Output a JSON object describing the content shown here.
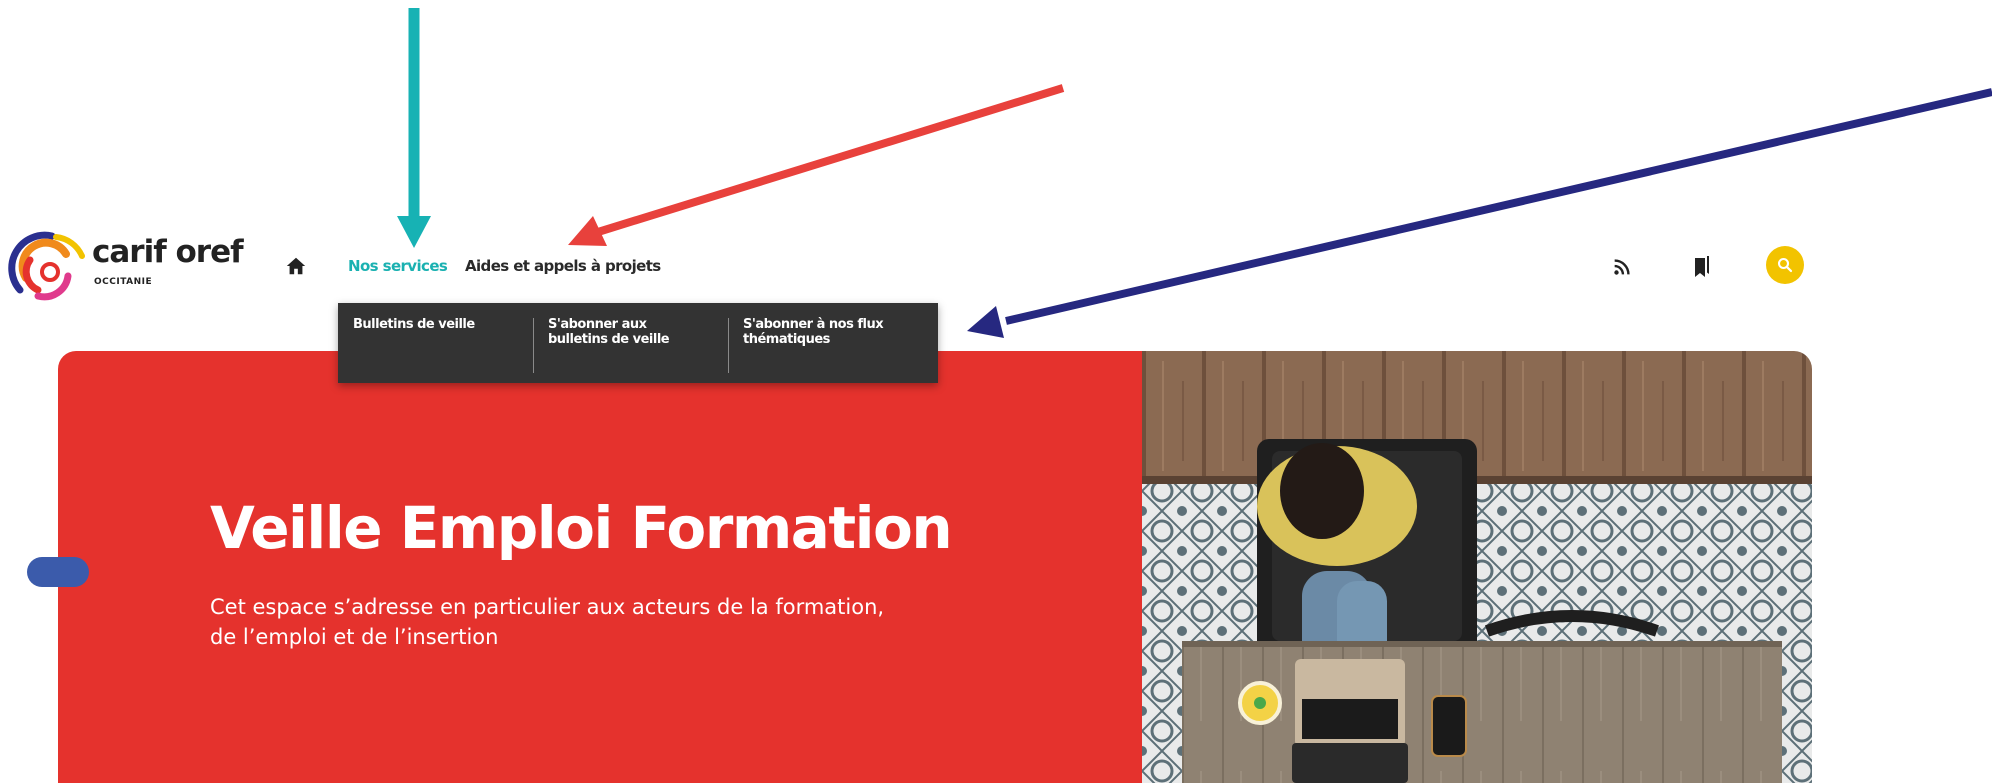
{
  "logo": {
    "name": "carif oref",
    "region": "OCCITANIE"
  },
  "nav": {
    "home_icon": "home-icon",
    "items": [
      {
        "label": "Nos services",
        "active": true
      },
      {
        "label": "Aides et appels à projets",
        "active": false
      }
    ]
  },
  "header_icons": {
    "rss": "rss-icon",
    "bookmarks": "bookmark-icon",
    "search": "search-icon"
  },
  "dropdown": {
    "items": [
      {
        "label": "Bulletins de veille"
      },
      {
        "label": "S'abonner aux bulletins de veille"
      },
      {
        "label": "S'abonner à nos flux thématiques"
      }
    ]
  },
  "hero": {
    "title": "Veille Emploi Formation",
    "description_line1": "Cet espace s’adresse en particulier aux acteurs de la formation,",
    "description_line2": "de l’emploi et de l’insertion",
    "image": "woman-working-on-laptop-top-view"
  },
  "annotations": {
    "arrows": [
      "teal-arrow",
      "red-arrow",
      "navy-arrow"
    ]
  },
  "colors": {
    "accent_teal": "#1ab1b1",
    "hero_red": "#e5322d",
    "search_yellow": "#f2c300",
    "dropdown_bg": "#333333",
    "arrow_red": "#e8413c",
    "arrow_navy": "#262880",
    "side_tab_blue": "#3b5bab"
  }
}
